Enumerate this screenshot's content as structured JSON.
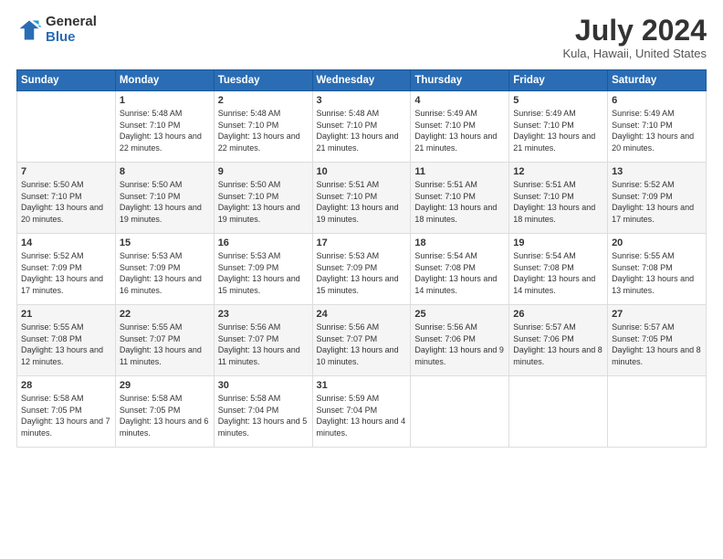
{
  "logo": {
    "general": "General",
    "blue": "Blue"
  },
  "header": {
    "title": "July 2024",
    "subtitle": "Kula, Hawaii, United States"
  },
  "weekdays": [
    "Sunday",
    "Monday",
    "Tuesday",
    "Wednesday",
    "Thursday",
    "Friday",
    "Saturday"
  ],
  "weeks": [
    [
      {
        "day": "",
        "sunrise": "",
        "sunset": "",
        "daylight": ""
      },
      {
        "day": "1",
        "sunrise": "5:48 AM",
        "sunset": "7:10 PM",
        "daylight": "13 hours and 22 minutes."
      },
      {
        "day": "2",
        "sunrise": "5:48 AM",
        "sunset": "7:10 PM",
        "daylight": "13 hours and 22 minutes."
      },
      {
        "day": "3",
        "sunrise": "5:48 AM",
        "sunset": "7:10 PM",
        "daylight": "13 hours and 21 minutes."
      },
      {
        "day": "4",
        "sunrise": "5:49 AM",
        "sunset": "7:10 PM",
        "daylight": "13 hours and 21 minutes."
      },
      {
        "day": "5",
        "sunrise": "5:49 AM",
        "sunset": "7:10 PM",
        "daylight": "13 hours and 21 minutes."
      },
      {
        "day": "6",
        "sunrise": "5:49 AM",
        "sunset": "7:10 PM",
        "daylight": "13 hours and 20 minutes."
      }
    ],
    [
      {
        "day": "7",
        "sunrise": "5:50 AM",
        "sunset": "7:10 PM",
        "daylight": "13 hours and 20 minutes."
      },
      {
        "day": "8",
        "sunrise": "5:50 AM",
        "sunset": "7:10 PM",
        "daylight": "13 hours and 19 minutes."
      },
      {
        "day": "9",
        "sunrise": "5:50 AM",
        "sunset": "7:10 PM",
        "daylight": "13 hours and 19 minutes."
      },
      {
        "day": "10",
        "sunrise": "5:51 AM",
        "sunset": "7:10 PM",
        "daylight": "13 hours and 19 minutes."
      },
      {
        "day": "11",
        "sunrise": "5:51 AM",
        "sunset": "7:10 PM",
        "daylight": "13 hours and 18 minutes."
      },
      {
        "day": "12",
        "sunrise": "5:51 AM",
        "sunset": "7:10 PM",
        "daylight": "13 hours and 18 minutes."
      },
      {
        "day": "13",
        "sunrise": "5:52 AM",
        "sunset": "7:09 PM",
        "daylight": "13 hours and 17 minutes."
      }
    ],
    [
      {
        "day": "14",
        "sunrise": "5:52 AM",
        "sunset": "7:09 PM",
        "daylight": "13 hours and 17 minutes."
      },
      {
        "day": "15",
        "sunrise": "5:53 AM",
        "sunset": "7:09 PM",
        "daylight": "13 hours and 16 minutes."
      },
      {
        "day": "16",
        "sunrise": "5:53 AM",
        "sunset": "7:09 PM",
        "daylight": "13 hours and 15 minutes."
      },
      {
        "day": "17",
        "sunrise": "5:53 AM",
        "sunset": "7:09 PM",
        "daylight": "13 hours and 15 minutes."
      },
      {
        "day": "18",
        "sunrise": "5:54 AM",
        "sunset": "7:08 PM",
        "daylight": "13 hours and 14 minutes."
      },
      {
        "day": "19",
        "sunrise": "5:54 AM",
        "sunset": "7:08 PM",
        "daylight": "13 hours and 14 minutes."
      },
      {
        "day": "20",
        "sunrise": "5:55 AM",
        "sunset": "7:08 PM",
        "daylight": "13 hours and 13 minutes."
      }
    ],
    [
      {
        "day": "21",
        "sunrise": "5:55 AM",
        "sunset": "7:08 PM",
        "daylight": "13 hours and 12 minutes."
      },
      {
        "day": "22",
        "sunrise": "5:55 AM",
        "sunset": "7:07 PM",
        "daylight": "13 hours and 11 minutes."
      },
      {
        "day": "23",
        "sunrise": "5:56 AM",
        "sunset": "7:07 PM",
        "daylight": "13 hours and 11 minutes."
      },
      {
        "day": "24",
        "sunrise": "5:56 AM",
        "sunset": "7:07 PM",
        "daylight": "13 hours and 10 minutes."
      },
      {
        "day": "25",
        "sunrise": "5:56 AM",
        "sunset": "7:06 PM",
        "daylight": "13 hours and 9 minutes."
      },
      {
        "day": "26",
        "sunrise": "5:57 AM",
        "sunset": "7:06 PM",
        "daylight": "13 hours and 8 minutes."
      },
      {
        "day": "27",
        "sunrise": "5:57 AM",
        "sunset": "7:05 PM",
        "daylight": "13 hours and 8 minutes."
      }
    ],
    [
      {
        "day": "28",
        "sunrise": "5:58 AM",
        "sunset": "7:05 PM",
        "daylight": "13 hours and 7 minutes."
      },
      {
        "day": "29",
        "sunrise": "5:58 AM",
        "sunset": "7:05 PM",
        "daylight": "13 hours and 6 minutes."
      },
      {
        "day": "30",
        "sunrise": "5:58 AM",
        "sunset": "7:04 PM",
        "daylight": "13 hours and 5 minutes."
      },
      {
        "day": "31",
        "sunrise": "5:59 AM",
        "sunset": "7:04 PM",
        "daylight": "13 hours and 4 minutes."
      },
      {
        "day": "",
        "sunrise": "",
        "sunset": "",
        "daylight": ""
      },
      {
        "day": "",
        "sunrise": "",
        "sunset": "",
        "daylight": ""
      },
      {
        "day": "",
        "sunrise": "",
        "sunset": "",
        "daylight": ""
      }
    ]
  ]
}
